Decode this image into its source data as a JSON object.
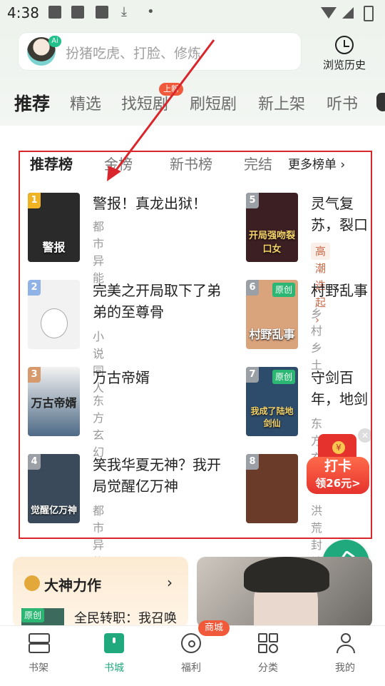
{
  "status_bar": {
    "time": "4:38"
  },
  "search": {
    "ai_badge": "Ai",
    "placeholder": "扮猪吃虎、打脸、修炼"
  },
  "history": {
    "label": "浏览历史"
  },
  "tabs": [
    {
      "label": "推荐",
      "active": true
    },
    {
      "label": "精选"
    },
    {
      "label": "找短剧",
      "badge": "上新"
    },
    {
      "label": "刷短剧"
    },
    {
      "label": "新上架"
    },
    {
      "label": "听书"
    }
  ],
  "ranking": {
    "tabs": [
      "推荐榜",
      "金榜",
      "新书榜",
      "完结"
    ],
    "more": "更多榜单 ›"
  },
  "books": [
    {
      "rank": "1",
      "title": "警报！真龙出狱！",
      "category": "都市异能",
      "cover_text": "警报",
      "rank_color": "#f0b323",
      "cover_color": "#2a2a2a"
    },
    {
      "rank": "2",
      "title": "完美之开局取下了弟弟的至尊骨",
      "category": "小说同人",
      "cover_text": "",
      "rank_color": "#8fb3e6",
      "cover_color": "#f2f2f2"
    },
    {
      "rank": "3",
      "title": "万古帝婿",
      "category": "东方玄幻",
      "cover_text": "万古帝婿",
      "rank_color": "#d69a6c",
      "cover_color": "#4e6a86"
    },
    {
      "rank": "4",
      "title": "笑我华夏无神？我开局觉醒亿万神",
      "category": "都市异能",
      "cover_text": "觉醒亿万神",
      "rank_color": "#9aa0a6",
      "cover_color": "#3a4a5a"
    },
    {
      "rank": "5",
      "title": "灵气复苏，裂口女",
      "category": "",
      "hot_tag": "高潮迭起 ›",
      "cover_text": "开局强吻裂口女",
      "rank_color": "#9aa0a6",
      "cover_color": "#3b1f22"
    },
    {
      "rank": "6",
      "title": "村野乱事",
      "category": "乡村乡土",
      "original": "原创",
      "cover_text": "村野乱事",
      "rank_color": "#9aa0a6",
      "cover_color": "#d9a37c"
    },
    {
      "rank": "7",
      "title": "守剑百年，地剑仙",
      "category": "东方玄幻",
      "original": "原创",
      "cover_text": "我成了陆地剑仙",
      "rank_color": "#9aa0a6",
      "cover_color": "#2d4b6a"
    },
    {
      "rank": "8",
      "title": "",
      "category": "洪荒封神",
      "cover_text": "",
      "rank_color": "#9aa0a6",
      "cover_color": "#6b3b2a"
    }
  ],
  "promo": {
    "line1": "打卡",
    "line2": "领26元>"
  },
  "dashen": {
    "title": "大神力作",
    "book_badge": "原创",
    "book_title": "全民转职：我召唤"
  },
  "navbar": {
    "items": [
      {
        "label": "书架",
        "icon": "bookshelf-icon"
      },
      {
        "label": "书城",
        "icon": "bookstore-icon",
        "active": true
      },
      {
        "label": "福利",
        "icon": "benefits-icon"
      },
      {
        "label": "分类",
        "icon": "categories-icon"
      },
      {
        "label": "我的",
        "icon": "profile-icon"
      }
    ],
    "mall_badge": "商城"
  },
  "colors": {
    "accent_green": "#1fa97c",
    "highlight_red": "#d9262c"
  }
}
